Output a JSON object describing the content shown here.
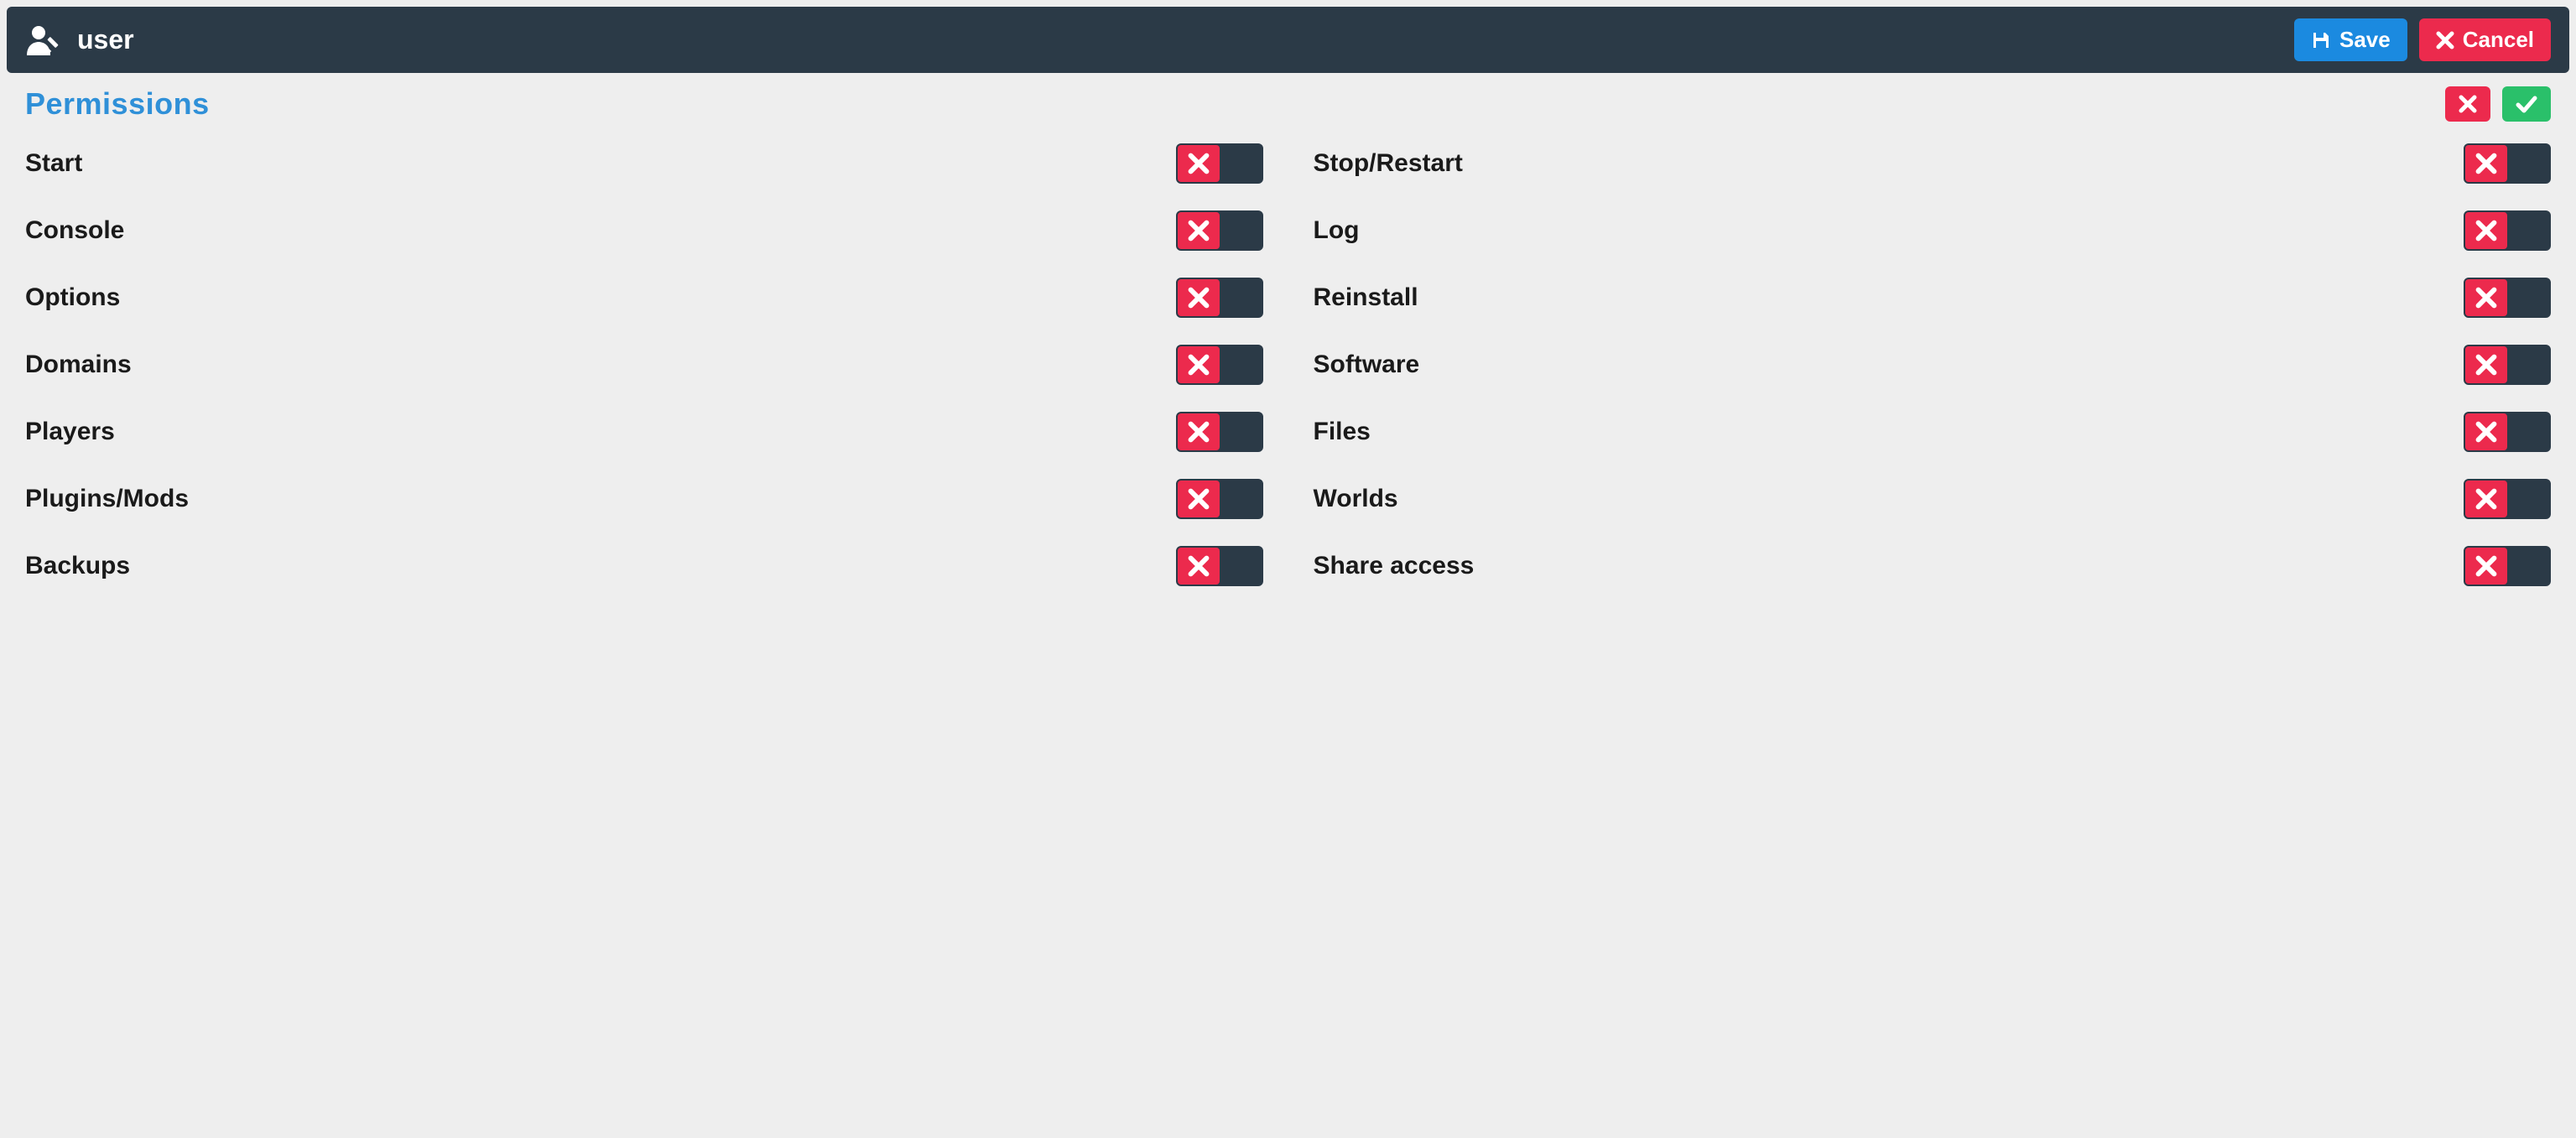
{
  "header": {
    "title": "user",
    "save_label": "Save",
    "cancel_label": "Cancel"
  },
  "section": {
    "title": "Permissions"
  },
  "colors": {
    "primary": "#1b8ae0",
    "danger": "#ec2a4d",
    "success": "#2ac06a",
    "panel": "#2b3a47",
    "accent_text": "#2f90d8"
  },
  "permissions": {
    "left": [
      {
        "label": "Start",
        "on": false
      },
      {
        "label": "Console",
        "on": false
      },
      {
        "label": "Options",
        "on": false
      },
      {
        "label": "Domains",
        "on": false
      },
      {
        "label": "Players",
        "on": false
      },
      {
        "label": "Plugins/Mods",
        "on": false
      },
      {
        "label": "Backups",
        "on": false
      }
    ],
    "right": [
      {
        "label": "Stop/Restart",
        "on": false
      },
      {
        "label": "Log",
        "on": false
      },
      {
        "label": "Reinstall",
        "on": false
      },
      {
        "label": "Software",
        "on": false
      },
      {
        "label": "Files",
        "on": false
      },
      {
        "label": "Worlds",
        "on": false
      },
      {
        "label": "Share access",
        "on": false
      }
    ]
  }
}
